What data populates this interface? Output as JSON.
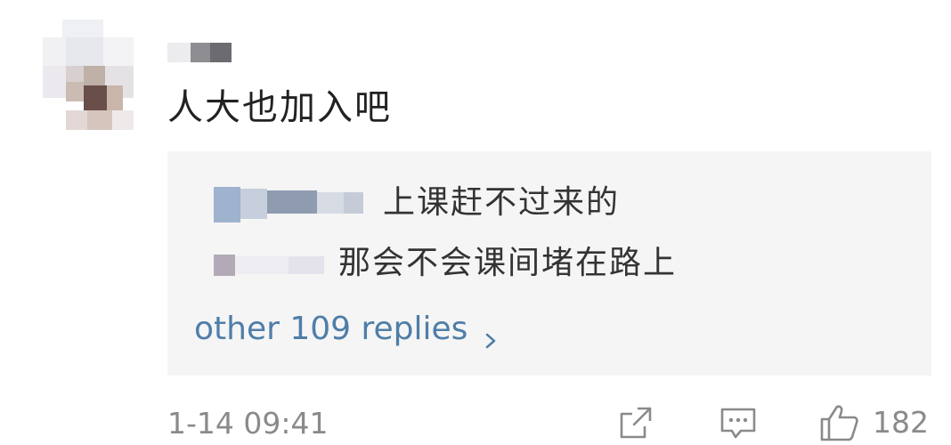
{
  "comment": {
    "text": "人大也加入吧"
  },
  "replies": [
    {
      "text": "上课赶不过来的"
    },
    {
      "text": "那会不会课间堵在路上"
    }
  ],
  "more_replies": {
    "label": "other 109 replies",
    "icon": "chevron-right-icon"
  },
  "footer": {
    "timestamp": "1-14 09:41",
    "like_count": "182",
    "icons": [
      "share-icon",
      "comment-icon",
      "thumbs-up-icon"
    ]
  },
  "colors": {
    "link": "#4f7ea8",
    "muted": "#8a8a8a",
    "reply_bg": "#f5f5f5",
    "text": "#222222"
  }
}
